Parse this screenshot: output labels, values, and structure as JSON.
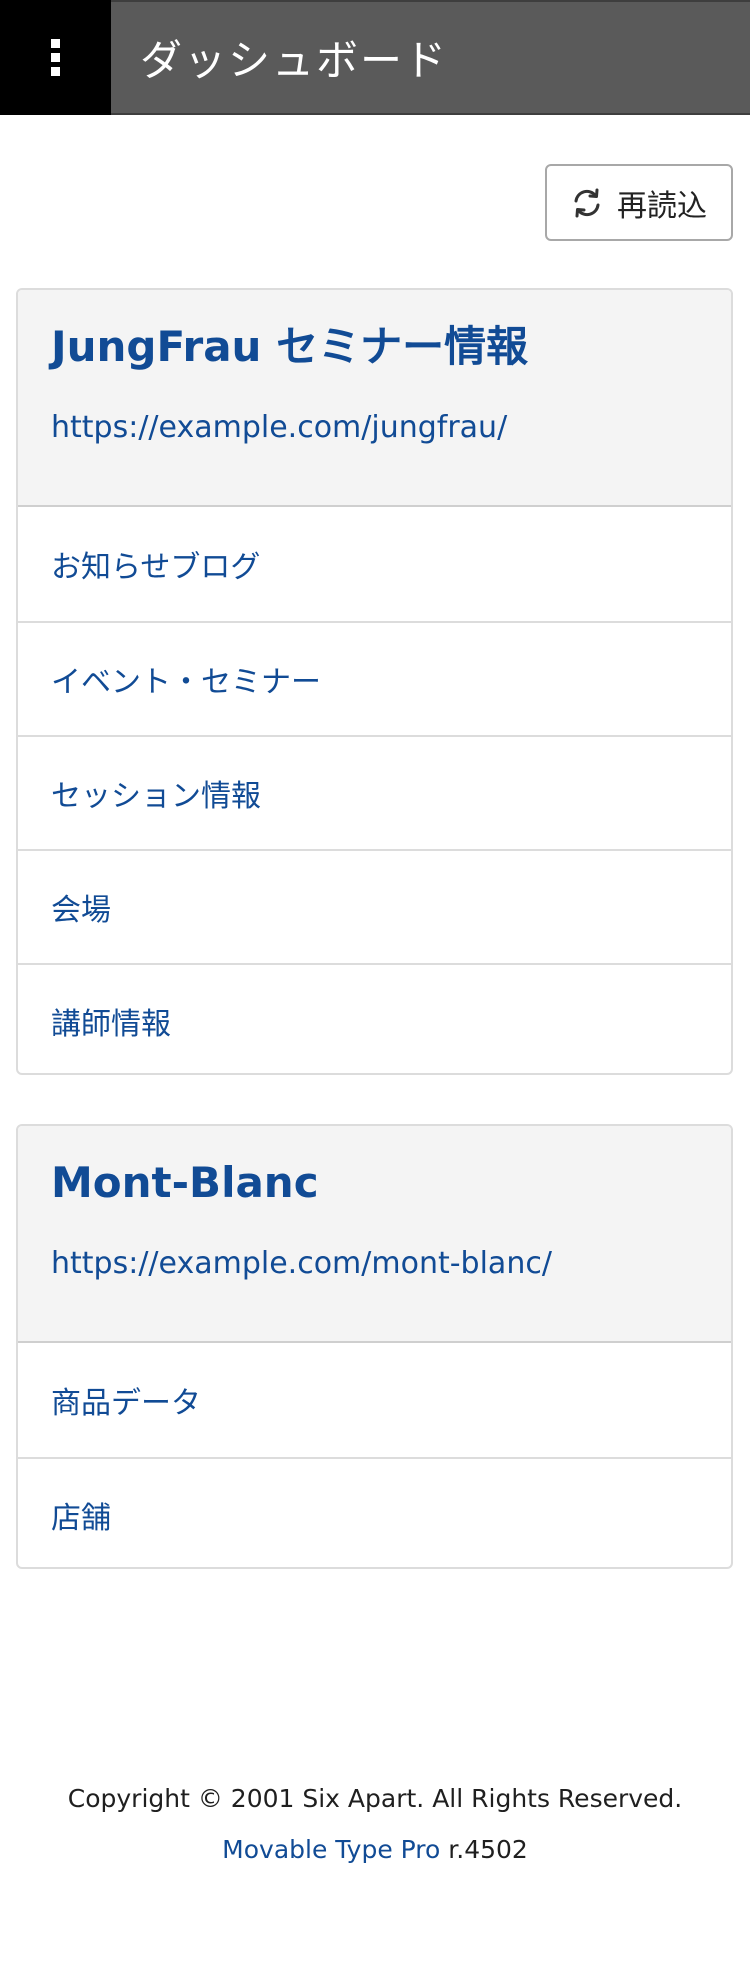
{
  "header": {
    "menu_icon": "kebab-menu-icon",
    "title": "ダッシュボード"
  },
  "reload": {
    "label": "再読込",
    "icon": "refresh-icon"
  },
  "sites": [
    {
      "title": "JungFrau セミナー情報",
      "url": "https://example.com/jungfrau/",
      "items": [
        {
          "label": "お知らせブログ"
        },
        {
          "label": "イベント・セミナー"
        },
        {
          "label": "セッション情報"
        },
        {
          "label": "会場"
        },
        {
          "label": "講師情報"
        }
      ]
    },
    {
      "title": "Mont-Blanc",
      "url": "https://example.com/mont-blanc/",
      "items": [
        {
          "label": "商品データ"
        },
        {
          "label": "店舗"
        }
      ]
    }
  ],
  "footer": {
    "copyright": "Copyright © 2001 Six Apart. All Rights Reserved.",
    "product": "Movable Type Pro",
    "revision": " r.4502"
  },
  "colors": {
    "header_menu_bg": "#000000",
    "header_title_bg": "#5a5a5a",
    "link": "#114b95",
    "card_head_bg": "#f4f4f4"
  }
}
